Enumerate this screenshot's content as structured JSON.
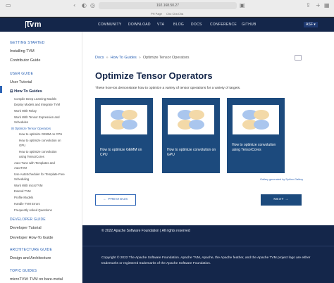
{
  "browser": {
    "url": "192.168.50.27",
    "tab_left": "PH Page",
    "tab_right": "Cho Cha Cha"
  },
  "header": {
    "logo": "tvm",
    "nav": [
      "COMMUNITY",
      "DOWNLOAD",
      "VTA",
      "BLOG",
      "DOCS",
      "CONFERENCE",
      "GITHUB"
    ],
    "asf": "ASF"
  },
  "sidebar": {
    "sections": [
      "GETTING STARTED",
      "USER GUIDE",
      "DEVELOPER GUIDE",
      "ARCHITECTURE GUIDE",
      "TOPIC GUIDES"
    ],
    "getting_started": [
      "Installing TVM",
      "Contributor Guide"
    ],
    "user_guide": [
      "User Tutorial",
      "How To Guides"
    ],
    "how_to": [
      "Compile Deep Learning Models",
      "Deploy Models and Integrate TVM",
      "Work With Relay",
      "Work With Tensor Expression and",
      "Schedules",
      "Optimize Tensor Operators",
      "How to optimize GEMM on CPU",
      "How to optimize convolution on",
      "GPU",
      "How to optimize convolution",
      "using TensorCores",
      "Auto-Tune with Templates and",
      "AutoTVM",
      "Use AutoScheduler for Template-Free",
      "Scheduling",
      "Work With microTVM",
      "Extend TVM",
      "Profile Models",
      "Handle TVM Errors",
      "Frequently Asked Questions"
    ],
    "developer": [
      "Developer Tutorial",
      "Developer How-To Guide"
    ],
    "architecture": [
      "Design and Architecture"
    ],
    "topic": [
      "microTVM: TVM on bare-metal"
    ]
  },
  "main": {
    "breadcrumb": [
      "Docs",
      "How To Guides",
      "Optimize Tensor Operators"
    ],
    "title": "Optimize Tensor Operators",
    "intro": "These how-tos demonstrate how to optimize a variety of tensor operations for a variety of targets.",
    "cards": [
      "How to optimize GEMM on CPU",
      "How to optimize convolution on GPU",
      "How to optimize convolution using TensorCores"
    ],
    "gallery_note": "Gallery generated by Sphinx-Gallery",
    "prev": "PREVIOUS",
    "next": "NEXT"
  },
  "footer": {
    "line1": "© 2022 Apache Software Foundation | All rights reserved",
    "line2": "Copyright © 2022 The Apache Software Foundation. Apache TVM, Apache, the Apache feather, and the Apache TVM project logo are either trademarks or registered trademarks of the Apache Software Foundation."
  },
  "colors": {
    "header_bg": "#14264a",
    "card_bg": "#1c4a7d",
    "link": "#2c63b5"
  }
}
